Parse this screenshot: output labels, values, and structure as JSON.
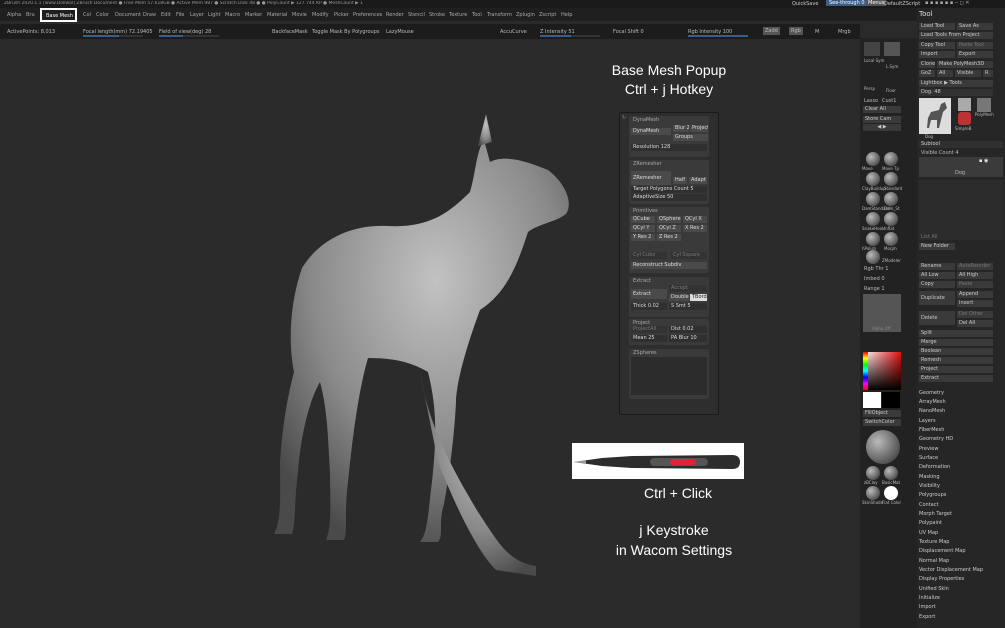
{
  "title_bar": {
    "text": "ZBrush 2020.1.1 [www.Dollwal]     ZBrush Document     ● Free Mem 57.618GB ● Active Mem 987 ● Scratch Disk 48 ●     ● PolyCount ▶ 127.744 KP ● MeshCount ▶ 1",
    "quicksave": "QuickSave",
    "see_through": "See-through  0",
    "menus_btn": "Menus",
    "default_zscript": "DefaultZScript"
  },
  "menu": {
    "items": [
      "Alpha",
      "Bru",
      "Base Mesh",
      "Col",
      "Color",
      "Document",
      "Draw",
      "Edit",
      "File",
      "Layer",
      "Light",
      "Macro",
      "Marker",
      "Material",
      "Movie",
      "Modify",
      "Picker",
      "Preferences",
      "Render",
      "Stencil",
      "Stroke",
      "Texture",
      "Tool",
      "Transform",
      "Zplugin",
      "Zscript",
      "Help"
    ]
  },
  "basemesh_label": "Base Mesh",
  "infobar": {
    "active_points": "ActivePoints: 8,013",
    "focal_length": "Focal length(mm) 72.19405",
    "field_of_view": "Field of view(deg) 28",
    "backface_mask": "BackfaceMask",
    "toggle_mask": "Toggle Mask By Polygroups",
    "lazy_mouse": "LazyMouse",
    "accucurve": "AccuCurve",
    "z_intensity": "Z Intensity 51",
    "focal_shift": "Focal Shift 0",
    "rgb_intensity": "Rgb Intensity 100",
    "zadd": "Zadd",
    "rgb": "Rgb",
    "m": "M",
    "mrgb": "Mrgb"
  },
  "overlay": {
    "popup_title_line1": "Base Mesh Popup",
    "popup_title_line2": "Ctrl + j Hotkey",
    "ctrl_click": "Ctrl + Click",
    "j_keystroke_line1": "j Keystroke",
    "j_keystroke_line2": "in Wacom Settings"
  },
  "popup": {
    "dynamesh": {
      "header": "DynaMesh",
      "dynamesh": "DynaMesh",
      "blur": "Blur 2",
      "project": "Project",
      "groups": "Groups",
      "resolution": "Resolution 128"
    },
    "zremesher": {
      "header": "ZRemesher",
      "zremesher": "ZRemesher",
      "half": "Half",
      "adapt": "Adapt",
      "target": "Target Polygons Count 5",
      "adaptive_size": "AdaptiveSize 50"
    },
    "primitives": {
      "header": "Primitives",
      "qcube": "QCube",
      "qsphere": "QSphere",
      "qcyl_x": "QCyl X",
      "qcyl_y": "QCyl Y",
      "qcyl_z": "QCyl Z",
      "x_res": "X Res 2",
      "y_res": "Y Res 2",
      "z_res": "Z Res 2",
      "cyl_cube": "Cyl Cube",
      "cyl_square": "Cyl Square",
      "reconstruct": "Reconstruct Subdiv"
    },
    "extract": {
      "header": "Extract",
      "extract": "Extract",
      "accept": "Accept",
      "double": "Double",
      "tborder": "TBorder",
      "thick": "Thick 0.02",
      "s_smt": "S Smt 5"
    },
    "project": {
      "header": "Project",
      "projectall": "ProjectAll",
      "dist": "Dist 0.02",
      "mean": "Mean 25",
      "pa_blur": "PA Blur 10"
    },
    "zspheres": {
      "header": "ZSpheres"
    }
  },
  "right_strip": {
    "labels": [
      "Scroll",
      "Zoom",
      "Actual",
      "AAHalf",
      "Local Sym",
      "L.Sym",
      "Persp",
      "Floor",
      "Lasso",
      "Cust1",
      "Clear All",
      "Store Cam"
    ],
    "brushes": [
      "Move",
      "Move Tp",
      "ClayBuildup",
      "Standard",
      "DamStandard",
      "Dam_St",
      "SnakeHook",
      "Inflat",
      "hPolish",
      "Morph",
      "ZModeler"
    ],
    "rgb_thr": "Rgb Thr 1",
    "imbed": "Imbed 0",
    "range": "Range 1",
    "alpha_off": "Alpha Off",
    "fill_object": "FillObject",
    "switch_color": "SwitchColor",
    "materials": [
      "zBClay",
      "BasicMat",
      "SkinShade",
      "Flat Color"
    ]
  },
  "tool_panel": {
    "header": "Tool",
    "load_tool": "Load Tool",
    "save_as": "Save As",
    "load_tools_project": "Load Tools From Project",
    "copy_tool": "Copy Tool",
    "paste_tool": "Paste Tool",
    "import": "Import",
    "export": "Export",
    "clone": "Clone",
    "make_polymesh": "Make PolyMesh3D",
    "goz": "GoZ",
    "all": "All",
    "visible": "Visible",
    "r": "R",
    "lightbox_tools": "Lightbox ▶ Tools",
    "dog_slider": "Dog. 48",
    "thumb_labels": [
      "Dog",
      "Cylinder3D",
      "SimpleB",
      "PolyMesh"
    ],
    "subtool_header": "Subtool",
    "visible_count": "Visible Count 4",
    "subtool_name": "Dog",
    "list_all": "List All",
    "new_folder": "New Folder",
    "rename": "Rename",
    "autoreorder": "AutoReorder",
    "all_low": "All Low",
    "all_high": "All High",
    "copy": "Copy",
    "paste": "Paste",
    "duplicate": "Duplicate",
    "append": "Append",
    "insert": "Insert",
    "delete": "Delete",
    "del_other": "Del Other",
    "del_all": "Del All",
    "split": "Split",
    "merge": "Merge",
    "boolean": "Boolean",
    "remesh": "Remesh",
    "project": "Project",
    "extract": "Extract",
    "sections": [
      "Geometry",
      "ArrayMesh",
      "NanoMesh",
      "Layers",
      "FiberMesh",
      "Geometry HD",
      "Preview",
      "Surface",
      "Deformation",
      "Masking",
      "Visibility",
      "Polygroups",
      "Contact",
      "Morph Target",
      "Polypaint",
      "UV Map",
      "Texture Map",
      "Displacement Map",
      "Normal Map",
      "Vector Displacement Map",
      "Display Properties",
      "Unified Skin",
      "Initialize",
      "Import",
      "Export"
    ]
  }
}
